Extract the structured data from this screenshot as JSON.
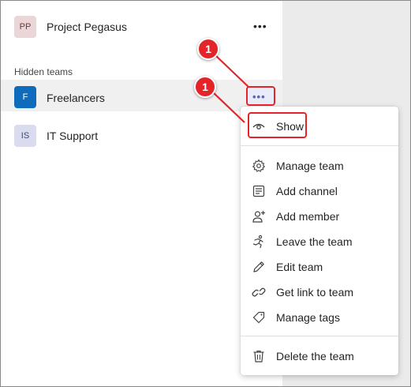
{
  "teams": [
    {
      "initials": "PP",
      "name": "Project Pegasus",
      "avatar_bg": "#ead5d7",
      "avatar_fg": "#6a3b3f",
      "more": "•••"
    },
    {
      "initials": "F",
      "name": "Freelancers",
      "avatar_bg": "#0f6cbd",
      "avatar_fg": "#ffffff",
      "more": "•••"
    },
    {
      "initials": "IS",
      "name": "IT Support",
      "avatar_bg": "#d9dbee",
      "avatar_fg": "#464775"
    }
  ],
  "hidden_teams_label": "Hidden teams",
  "menu": {
    "show": "Show",
    "manage_team": "Manage team",
    "add_channel": "Add channel",
    "add_member": "Add member",
    "leave_team": "Leave the team",
    "edit_team": "Edit team",
    "get_link": "Get link to team",
    "manage_tags": "Manage tags",
    "delete_team": "Delete the team"
  },
  "callouts": [
    "1",
    "1"
  ],
  "colors": {
    "accent": "#6264a7",
    "callout": "#e3242b",
    "hover_row": "#f0f0f0"
  }
}
